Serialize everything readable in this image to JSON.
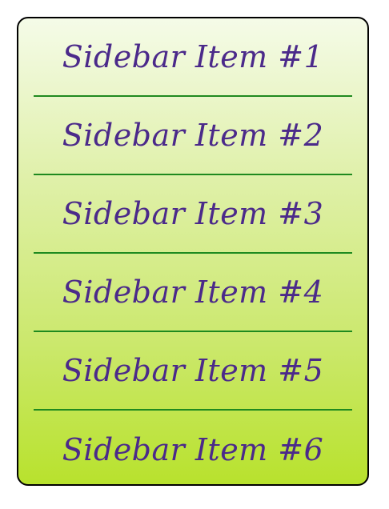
{
  "sidebar": {
    "items": [
      {
        "label": "Sidebar Item #1"
      },
      {
        "label": "Sidebar Item #2"
      },
      {
        "label": "Sidebar Item #3"
      },
      {
        "label": "Sidebar Item #4"
      },
      {
        "label": "Sidebar Item #5"
      },
      {
        "label": "Sidebar Item #6"
      }
    ]
  },
  "colors": {
    "text": "#4b2a8a",
    "divider": "#1f8a1f",
    "gradient_top": "#f5fbe8",
    "gradient_bottom": "#b8e22d",
    "border": "#000000"
  }
}
